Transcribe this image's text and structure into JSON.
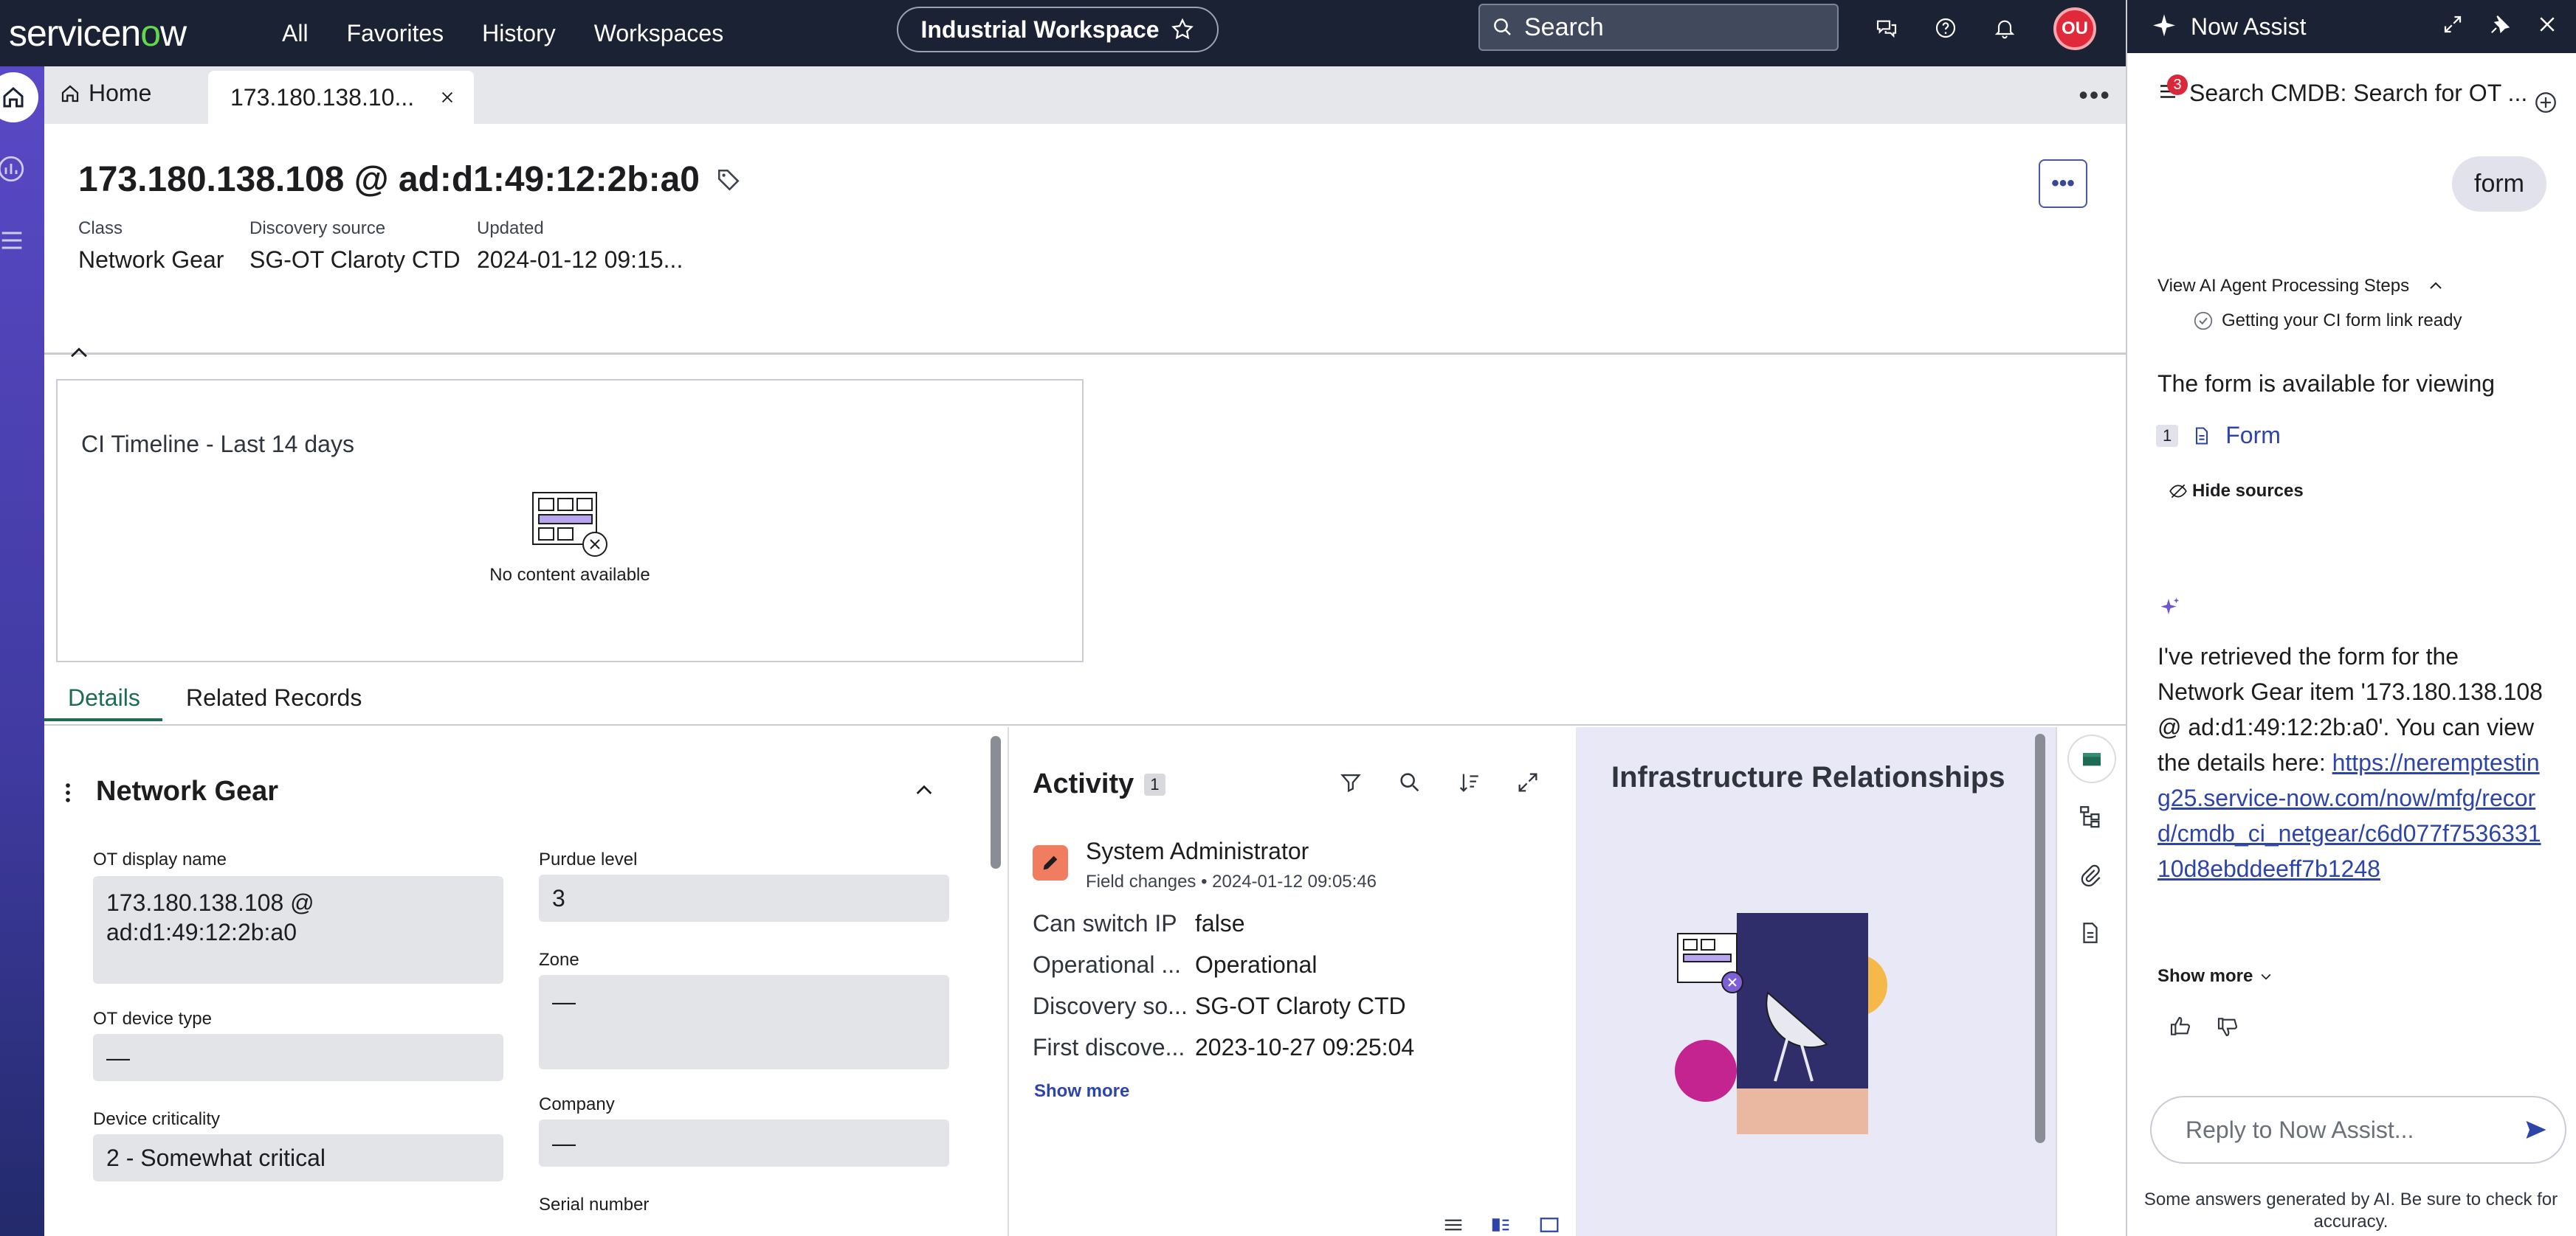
{
  "nav": {
    "brand_prefix": "servicen",
    "brand_o": "o",
    "brand_suffix": "w",
    "all": "All",
    "favorites": "Favorites",
    "history": "History",
    "workspaces": "Workspaces",
    "workspace_pill": "Industrial Workspace",
    "search": "Search",
    "avatar": "OU"
  },
  "tabs": {
    "home": "Home",
    "active": "173.180.138.10..."
  },
  "record": {
    "title": "173.180.138.108 @ ad:d1:49:12:2b:a0",
    "class_label": "Class",
    "class_value": "Network Gear",
    "source_label": "Discovery source",
    "source_value": "SG-OT Claroty CTD",
    "updated_label": "Updated",
    "updated_value": "2024-01-12 09:15...",
    "more": "•••"
  },
  "timeline": {
    "title": "CI Timeline - Last 14 days",
    "empty": "No content available"
  },
  "subtabs": {
    "details": "Details",
    "related": "Related Records"
  },
  "section": {
    "title": "Network Gear",
    "fields": {
      "ot_display_name_label": "OT display name",
      "ot_display_name": "173.180.138.108 @ ad:d1:49:12:2b:a0",
      "purdue_label": "Purdue level",
      "purdue": "3",
      "zone_label": "Zone",
      "zone": "—",
      "ot_device_type_label": "OT device type",
      "ot_device_type": "—",
      "company_label": "Company",
      "company": "—",
      "criticality_label": "Device criticality",
      "criticality": "2 - Somewhat critical",
      "serial_label": "Serial number"
    }
  },
  "activity": {
    "title": "Activity",
    "count": "1",
    "user": "System Administrator",
    "subtitle": "Field changes • 2024-01-12 09:05:46",
    "rows": [
      {
        "k": "Can switch IP",
        "v": "false"
      },
      {
        "k": "Operational ...",
        "v": "Operational"
      },
      {
        "k": "Discovery so...",
        "v": "SG-OT Claroty CTD"
      },
      {
        "k": "First discove...",
        "v": "2023-10-27 09:25:04"
      }
    ],
    "show_more": "Show more"
  },
  "infra": {
    "title": "Infrastructure Relationships"
  },
  "assist": {
    "title": "Now Assist",
    "badge": "3",
    "conversation": "Search CMDB: Search for OT ...",
    "user_msg": "form",
    "steps_label": "View AI Agent Processing Steps",
    "step1": "Getting your CI form link ready",
    "available": "The form is available for viewing",
    "source_num": "1",
    "source_label": "Form",
    "hide_sources": "Hide sources",
    "answer_1": "I've retrieved the form for the Network Gear item '173.180.138.108 @ ad:d1:49:12:2b:a0'. You can view the details here: ",
    "answer_link": "https://neremptesting25.service-now.com/now/mfg/record/cmdb_ci_netgear/c6d077f753633110d8ebddeeff7b1248",
    "show_more": "Show more",
    "reply_placeholder": "Reply to Now Assist...",
    "disclaimer": "Some answers generated by AI. Be sure to check for accuracy."
  }
}
